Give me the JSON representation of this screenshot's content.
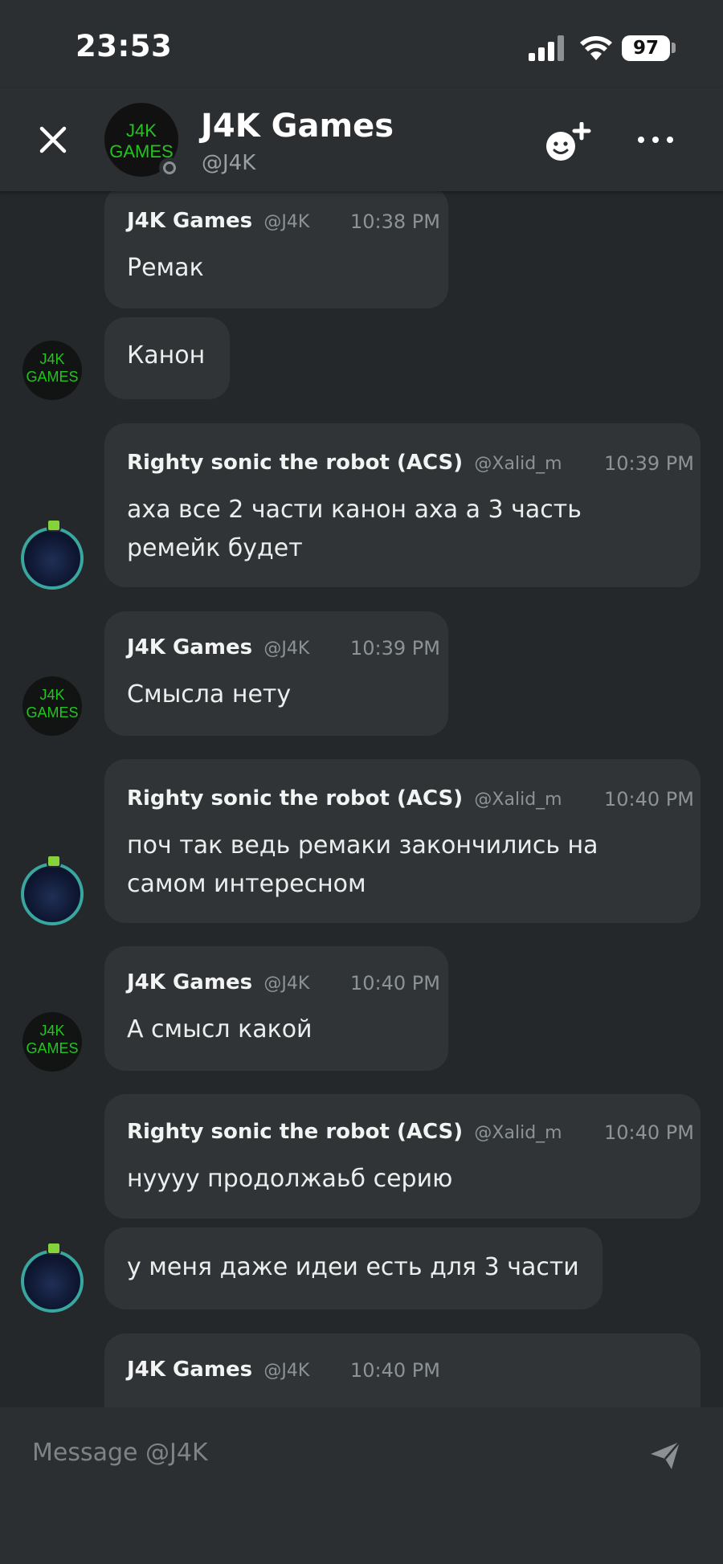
{
  "status_bar": {
    "time": "23:53",
    "battery": "97"
  },
  "header": {
    "title": "J4K Games",
    "handle": "@J4K",
    "avatar_logo_line1": "J4K",
    "avatar_logo_line2": "GAMES"
  },
  "messages": [
    {
      "author": "J4K Games",
      "handle": "@J4K",
      "time": "10:38 PM",
      "text": "Ремак"
    },
    {
      "text": "Канон"
    },
    {
      "author": "Righty sonic the robot (ACS)",
      "handle": "@Xalid_m",
      "time": "10:39 PM",
      "line1": "аха все 2 части канон аха а 3 часть",
      "line2": "ремейк будет"
    },
    {
      "author": "J4K Games",
      "handle": "@J4K",
      "time": "10:39 PM",
      "text": "Смысла нету"
    },
    {
      "author": "Righty sonic the robot (ACS)",
      "handle": "@Xalid_m",
      "time": "10:40 PM",
      "line1": "поч так ведь ремаки закончились на",
      "line2": "самом интересном"
    },
    {
      "author": "J4K Games",
      "handle": "@J4K",
      "time": "10:40 PM",
      "text": "А смысл какой"
    },
    {
      "author": "Righty sonic the robot (ACS)",
      "handle": "@Xalid_m",
      "time": "10:40 PM",
      "text": "нуууу продолжаьб серию"
    },
    {
      "text": "у меня даже идеи есть для 3 части"
    },
    {
      "author": "J4K Games",
      "handle": "@J4K",
      "time": "10:40 PM"
    }
  ],
  "composer": {
    "placeholder": "Message @J4K"
  },
  "icons": {
    "close": "close-icon",
    "add_friend": "add-friend-icon",
    "more": "more-icon",
    "send": "send-icon"
  },
  "colors": {
    "background": "#24282a",
    "bubble": "#303436",
    "bar": "#2b2f31",
    "logo_green": "#23c41f",
    "ring_teal": "#3aa6a0"
  }
}
